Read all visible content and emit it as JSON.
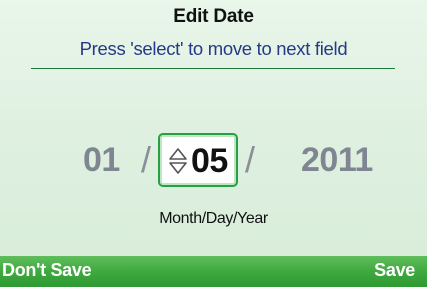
{
  "header": {
    "title": "Edit Date",
    "hint": "Press 'select' to move to next field"
  },
  "date": {
    "month": "01",
    "day": "05",
    "year": "2011",
    "separator": "/",
    "format_label": "Month/Day/Year"
  },
  "icons": {
    "spinner": "up-down-spinner-icon"
  },
  "softkeys": {
    "left": "Don't Save",
    "right": "Save"
  },
  "colors": {
    "accent": "#2f9a33",
    "hint_text": "#243a86",
    "inactive_field": "#7f8591",
    "focus_border": "#279f43"
  }
}
